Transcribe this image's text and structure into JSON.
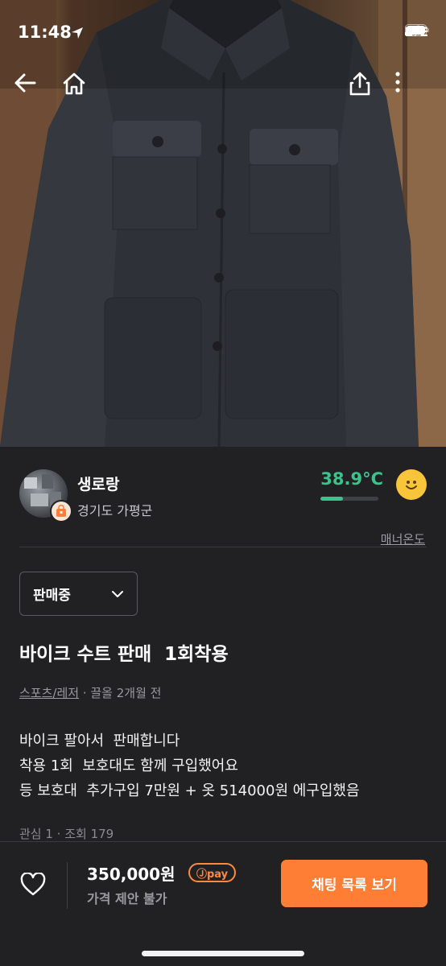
{
  "status_bar": {
    "time": "11:48",
    "network": "LTE"
  },
  "icons": {
    "back": "arrow-left-icon",
    "home": "home-icon",
    "share": "share-icon",
    "more": "more-vertical-icon",
    "location_arrow": "location-arrow-icon",
    "signal": "signal-bars-icon",
    "battery": "battery-icon",
    "chevron": "chevron-down-icon",
    "heart": "heart-icon",
    "smile": "smile-face-icon",
    "badge": "bag-badge-icon"
  },
  "seller": {
    "name": "생로랑",
    "location": "경기도 가평군",
    "temperature": "38.9°C",
    "temperature_level": 0.389,
    "manner_label": "매너온도"
  },
  "post": {
    "status": "판매중",
    "title": "바이크 수트 판매  1회착용",
    "category": "스포츠/레저",
    "time_ago": " · 끌올 2개월 전",
    "description": "바이크 팔아서  판매합니다\n착용 1회  보호대도 함께 구입했어요\n등 보호대  추가구입 7만원 + 옷 514000원 에구입했음",
    "stats": "관심 1 · 조회 179"
  },
  "bottom": {
    "price": "350,000원",
    "pay_label": "Ⓙpay",
    "offer": "가격 제안 불가",
    "chat_button": "채팅 목록 보기"
  },
  "colors": {
    "background": "#212124",
    "accent": "#ff7e36",
    "temperature": "#3bc38b"
  }
}
